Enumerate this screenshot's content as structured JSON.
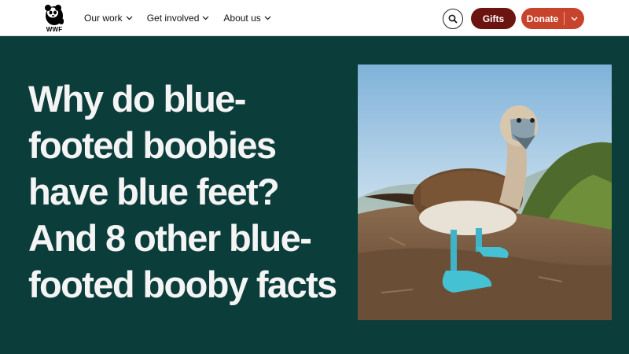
{
  "header": {
    "logo_text": "WWF",
    "nav": [
      {
        "label": "Our work"
      },
      {
        "label": "Get involved"
      },
      {
        "label": "About us"
      }
    ],
    "gifts_label": "Gifts",
    "donate_label": "Donate"
  },
  "article": {
    "title": "Why do blue-footed boobies have blue feet? And 8 other blue-footed booby facts"
  },
  "colors": {
    "background": "#0b3d3a",
    "gifts": "#6b1410",
    "donate": "#c8432b"
  },
  "icons": {
    "logo": "panda-logo-icon",
    "search": "search-icon",
    "nav_chevron": "chevron-down-icon",
    "donate_caret": "chevron-down-icon"
  }
}
